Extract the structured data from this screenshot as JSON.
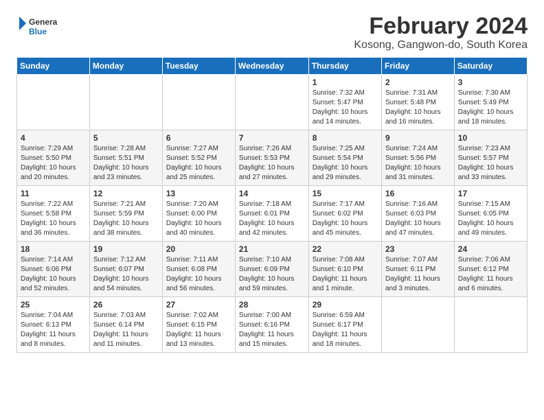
{
  "header": {
    "logo_general": "General",
    "logo_blue": "Blue",
    "month_title": "February 2024",
    "location": "Kosong, Gangwon-do, South Korea"
  },
  "weekdays": [
    "Sunday",
    "Monday",
    "Tuesday",
    "Wednesday",
    "Thursday",
    "Friday",
    "Saturday"
  ],
  "weeks": [
    [
      {
        "day": "",
        "info": ""
      },
      {
        "day": "",
        "info": ""
      },
      {
        "day": "",
        "info": ""
      },
      {
        "day": "",
        "info": ""
      },
      {
        "day": "1",
        "info": "Sunrise: 7:32 AM\nSunset: 5:47 PM\nDaylight: 10 hours\nand 14 minutes."
      },
      {
        "day": "2",
        "info": "Sunrise: 7:31 AM\nSunset: 5:48 PM\nDaylight: 10 hours\nand 16 minutes."
      },
      {
        "day": "3",
        "info": "Sunrise: 7:30 AM\nSunset: 5:49 PM\nDaylight: 10 hours\nand 18 minutes."
      }
    ],
    [
      {
        "day": "4",
        "info": "Sunrise: 7:29 AM\nSunset: 5:50 PM\nDaylight: 10 hours\nand 20 minutes."
      },
      {
        "day": "5",
        "info": "Sunrise: 7:28 AM\nSunset: 5:51 PM\nDaylight: 10 hours\nand 23 minutes."
      },
      {
        "day": "6",
        "info": "Sunrise: 7:27 AM\nSunset: 5:52 PM\nDaylight: 10 hours\nand 25 minutes."
      },
      {
        "day": "7",
        "info": "Sunrise: 7:26 AM\nSunset: 5:53 PM\nDaylight: 10 hours\nand 27 minutes."
      },
      {
        "day": "8",
        "info": "Sunrise: 7:25 AM\nSunset: 5:54 PM\nDaylight: 10 hours\nand 29 minutes."
      },
      {
        "day": "9",
        "info": "Sunrise: 7:24 AM\nSunset: 5:56 PM\nDaylight: 10 hours\nand 31 minutes."
      },
      {
        "day": "10",
        "info": "Sunrise: 7:23 AM\nSunset: 5:57 PM\nDaylight: 10 hours\nand 33 minutes."
      }
    ],
    [
      {
        "day": "11",
        "info": "Sunrise: 7:22 AM\nSunset: 5:58 PM\nDaylight: 10 hours\nand 36 minutes."
      },
      {
        "day": "12",
        "info": "Sunrise: 7:21 AM\nSunset: 5:59 PM\nDaylight: 10 hours\nand 38 minutes."
      },
      {
        "day": "13",
        "info": "Sunrise: 7:20 AM\nSunset: 6:00 PM\nDaylight: 10 hours\nand 40 minutes."
      },
      {
        "day": "14",
        "info": "Sunrise: 7:18 AM\nSunset: 6:01 PM\nDaylight: 10 hours\nand 42 minutes."
      },
      {
        "day": "15",
        "info": "Sunrise: 7:17 AM\nSunset: 6:02 PM\nDaylight: 10 hours\nand 45 minutes."
      },
      {
        "day": "16",
        "info": "Sunrise: 7:16 AM\nSunset: 6:03 PM\nDaylight: 10 hours\nand 47 minutes."
      },
      {
        "day": "17",
        "info": "Sunrise: 7:15 AM\nSunset: 6:05 PM\nDaylight: 10 hours\nand 49 minutes."
      }
    ],
    [
      {
        "day": "18",
        "info": "Sunrise: 7:14 AM\nSunset: 6:06 PM\nDaylight: 10 hours\nand 52 minutes."
      },
      {
        "day": "19",
        "info": "Sunrise: 7:12 AM\nSunset: 6:07 PM\nDaylight: 10 hours\nand 54 minutes."
      },
      {
        "day": "20",
        "info": "Sunrise: 7:11 AM\nSunset: 6:08 PM\nDaylight: 10 hours\nand 56 minutes."
      },
      {
        "day": "21",
        "info": "Sunrise: 7:10 AM\nSunset: 6:09 PM\nDaylight: 10 hours\nand 59 minutes."
      },
      {
        "day": "22",
        "info": "Sunrise: 7:08 AM\nSunset: 6:10 PM\nDaylight: 11 hours\nand 1 minute."
      },
      {
        "day": "23",
        "info": "Sunrise: 7:07 AM\nSunset: 6:11 PM\nDaylight: 11 hours\nand 3 minutes."
      },
      {
        "day": "24",
        "info": "Sunrise: 7:06 AM\nSunset: 6:12 PM\nDaylight: 11 hours\nand 6 minutes."
      }
    ],
    [
      {
        "day": "25",
        "info": "Sunrise: 7:04 AM\nSunset: 6:13 PM\nDaylight: 11 hours\nand 8 minutes."
      },
      {
        "day": "26",
        "info": "Sunrise: 7:03 AM\nSunset: 6:14 PM\nDaylight: 11 hours\nand 11 minutes."
      },
      {
        "day": "27",
        "info": "Sunrise: 7:02 AM\nSunset: 6:15 PM\nDaylight: 11 hours\nand 13 minutes."
      },
      {
        "day": "28",
        "info": "Sunrise: 7:00 AM\nSunset: 6:16 PM\nDaylight: 11 hours\nand 15 minutes."
      },
      {
        "day": "29",
        "info": "Sunrise: 6:59 AM\nSunset: 6:17 PM\nDaylight: 11 hours\nand 18 minutes."
      },
      {
        "day": "",
        "info": ""
      },
      {
        "day": "",
        "info": ""
      }
    ]
  ]
}
